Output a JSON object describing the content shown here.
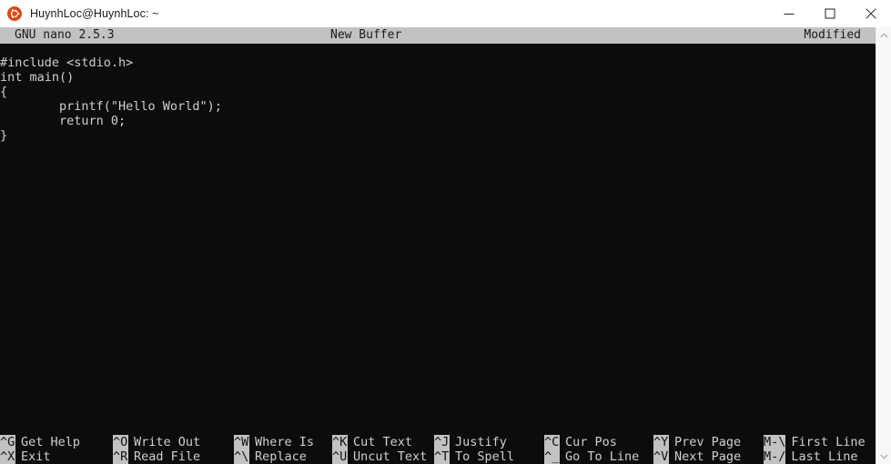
{
  "window": {
    "title": "HuynhLoc@HuynhLoc: ~",
    "icon": "ubuntu-logo-icon",
    "controls": {
      "minimize": "minimize-icon",
      "maximize": "maximize-icon",
      "close": "close-icon"
    }
  },
  "nano": {
    "version": "GNU nano 2.5.3",
    "buffer": "New Buffer",
    "modified": "Modified"
  },
  "editor": {
    "lines": [
      "#include <stdio.h>",
      "int main()",
      "{",
      "        printf(\"Hello World\");",
      "        return 0;",
      "}"
    ]
  },
  "shortcuts": {
    "row1": [
      {
        "key": "^G",
        "label": "Get Help"
      },
      {
        "key": "^O",
        "label": "Write Out"
      },
      {
        "key": "^W",
        "label": "Where Is"
      },
      {
        "key": "^K",
        "label": "Cut Text"
      },
      {
        "key": "^J",
        "label": "Justify"
      },
      {
        "key": "^C",
        "label": "Cur Pos"
      },
      {
        "key": "^Y",
        "label": "Prev Page"
      },
      {
        "key": "M-\\",
        "label": "First Line"
      }
    ],
    "row2": [
      {
        "key": "^X",
        "label": "Exit"
      },
      {
        "key": "^R",
        "label": "Read File"
      },
      {
        "key": "^\\",
        "label": "Replace"
      },
      {
        "key": "^U",
        "label": "Uncut Text"
      },
      {
        "key": "^T",
        "label": "To Spell"
      },
      {
        "key": "^_",
        "label": "Go To Line"
      },
      {
        "key": "^V",
        "label": "Next Page"
      },
      {
        "key": "M-/",
        "label": "Last Line"
      }
    ]
  },
  "scrollbar": {
    "up": "scroll-up-arrow-icon",
    "down": "scroll-down-arrow-icon"
  },
  "colors": {
    "terminal_bg": "#0c0c0c",
    "terminal_fg": "#d0d0d0",
    "statusbar_bg": "#c2c2c2",
    "titlebar_bg": "#ffffff",
    "ubuntu_orange": "#dd4814"
  }
}
